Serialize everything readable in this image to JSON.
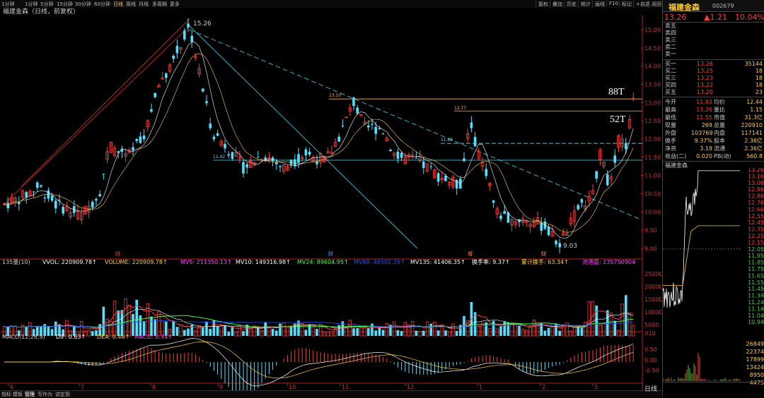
{
  "toolbar": {
    "periods": [
      "1分钟",
      "1分钟",
      "5分钟",
      "15分钟",
      "30分钟",
      "60分钟",
      "日线",
      "周线",
      "月线",
      "多周期",
      "更多"
    ],
    "active_period": "日线",
    "buttons": [
      "复权",
      "叠加",
      "历史",
      "统计",
      "画线",
      "F10",
      "标记",
      "+自选",
      "返回"
    ]
  },
  "main_chart": {
    "title": "福建金森（日线，前复权）",
    "high_label": "15.26",
    "low_label": "9.03",
    "price_axis": [
      "15.00",
      "14.50",
      "14.00",
      "13.50",
      "13.00",
      "12.50",
      "12.00",
      "11.50",
      "11.00",
      "10.50",
      "10.00",
      "9.50",
      "9.00"
    ],
    "level_labels": [
      "13.10",
      "12.77",
      "11.88",
      "11.42"
    ],
    "big_labels": [
      "88T",
      "52T"
    ],
    "event_markers": [
      "财",
      "财",
      "增",
      "财"
    ],
    "ma_colors": {
      "ma5": "#ffffff",
      "ma10": "#ffcf30",
      "ma20": "#ff40ff",
      "ma60": "#40ff40"
    },
    "up_color": "#ff3b3b",
    "down_color": "#50e0ff"
  },
  "volume_panel": {
    "header": [
      "135量(10)",
      "VVOL: 220909.78↑",
      "VOLUME: 220909.78↑",
      "MV5: 211350.13↑",
      "MV10: 149316.98↑",
      "MV24: 89604.95↑",
      "MV60: 46501.26↑",
      "MV135: 41406.35↑",
      "换手率: 9.37↑",
      "累计换手: 63.34↑",
      "流通盘: 235750904"
    ],
    "axis": [
      "25000",
      "20000",
      "15000",
      "10000",
      "5000",
      "X10"
    ]
  },
  "macd_panel": {
    "header": [
      "MACD(12,26,9)",
      "DIF: 0.63↑",
      "DEA: 0.46↑",
      "MACD: 0.34↑"
    ],
    "axis": [
      "0.50",
      "0.00",
      "-0.50"
    ]
  },
  "date_axis": [
    "6",
    "7",
    "8",
    "9",
    "10",
    "11",
    "12",
    "1",
    "2",
    "3"
  ],
  "bottom_tabs": [
    "指标",
    "模板",
    "管理",
    "写作为",
    "讲定到"
  ],
  "right_panel": {
    "name": "福建金森",
    "code": "002679",
    "price": "13.26",
    "change": "▲1.21",
    "pct": "10.04%",
    "asks": [
      {
        "label": "卖五",
        "price": "",
        "vol": ""
      },
      {
        "label": "卖四",
        "price": "",
        "vol": ""
      },
      {
        "label": "卖三",
        "price": "",
        "vol": ""
      },
      {
        "label": "卖二",
        "price": "",
        "vol": ""
      },
      {
        "label": "卖一",
        "price": "",
        "vol": ""
      }
    ],
    "bids": [
      {
        "label": "买一",
        "price": "13.26",
        "vol": "35144"
      },
      {
        "label": "买二",
        "price": "13.25",
        "vol": "18"
      },
      {
        "label": "买三",
        "price": "13.23",
        "vol": "18"
      },
      {
        "label": "买四",
        "price": "13.22",
        "vol": "18"
      },
      {
        "label": "买五",
        "price": "13.20",
        "vol": "23"
      }
    ],
    "stats": [
      {
        "l1": "今开",
        "v1": "11.93",
        "l2": "均价",
        "v2": "12.44"
      },
      {
        "l1": "最高",
        "v1": "13.26",
        "l2": "量比",
        "v2": "1.15"
      },
      {
        "l1": "最低",
        "v1": "11.55",
        "l2": "市值",
        "v2": "31.3亿"
      },
      {
        "l1": "现量",
        "v1": "269",
        "l2": "总量",
        "v2": "220910"
      },
      {
        "l1": "外盘",
        "v1": "103769",
        "l2": "内盘",
        "v2": "117141"
      },
      {
        "l1": "换手",
        "v1": "9.37%",
        "l2": "股本",
        "v2": "2.36亿"
      },
      {
        "l1": "净资",
        "v1": "3.19",
        "l2": "流通",
        "v2": "2.36亿"
      },
      {
        "l1": "收益(二)",
        "v1": "0.020",
        "l2": "PB(动)",
        "v2": "560.8"
      }
    ],
    "mini_title": "福建金森",
    "mini_axis": [
      "13.26",
      "13.16",
      "13.06",
      "12.96",
      "12.86",
      "12.76",
      "12.66",
      "12.55",
      "12.45",
      "12.35",
      "12.25",
      "12.15",
      "12.05",
      "11.95",
      "11.85",
      "11.75",
      "11.65",
      "11.55",
      "11.45",
      "11.34",
      "11.24",
      "11.14",
      "11.04",
      "10.94"
    ],
    "mini_vol_axis": [
      "26849",
      "22374",
      "17899",
      "13424",
      "8950",
      "4475"
    ],
    "mini_tab": "日线"
  }
}
